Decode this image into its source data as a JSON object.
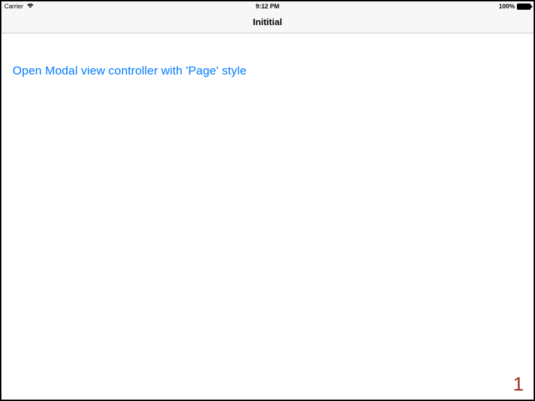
{
  "status_bar": {
    "carrier": "Carrier",
    "time": "9:12 PM",
    "battery_percent": "100%"
  },
  "nav": {
    "title": "Inititial"
  },
  "content": {
    "open_modal_label": "Open Modal view controller with 'Page' style"
  },
  "page_number": "1"
}
